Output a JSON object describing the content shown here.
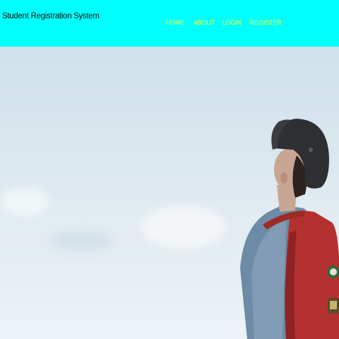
{
  "header": {
    "brand": "Student Registration System",
    "nav": [
      {
        "label": "HOME"
      },
      {
        "label": "ABOUT"
      },
      {
        "label": "LOGIN"
      },
      {
        "label": "REGISTER"
      }
    ],
    "background_color": "#00ffff",
    "nav_color": "#f3ff3a"
  },
  "hero": {
    "image": "student-with-backpack-looking-at-sky"
  }
}
